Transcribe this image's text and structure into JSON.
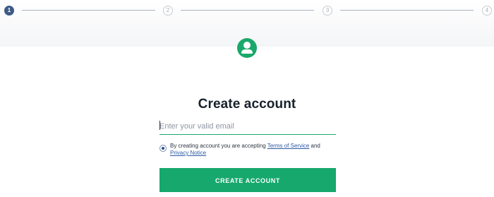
{
  "stepper": {
    "steps": [
      {
        "label": "1",
        "state": "active"
      },
      {
        "label": "2",
        "state": "inactive"
      },
      {
        "label": "3",
        "state": "inactive"
      },
      {
        "label": "4",
        "state": "inactive"
      }
    ]
  },
  "form": {
    "title": "Create account",
    "email_placeholder": "Enter your valid email",
    "email_value": "",
    "consent_prefix": "By creating account you are accepting ",
    "terms_link": "Terms of Service",
    "consent_and": " and",
    "privacy_link": "Privacy Notice",
    "submit_label": "CREATE ACCOUNT"
  },
  "colors": {
    "accent_green": "#16a86c",
    "step_active": "#3e5a86",
    "link_blue": "#2e5aa6"
  },
  "icons": {
    "avatar": "user-circle-icon"
  }
}
